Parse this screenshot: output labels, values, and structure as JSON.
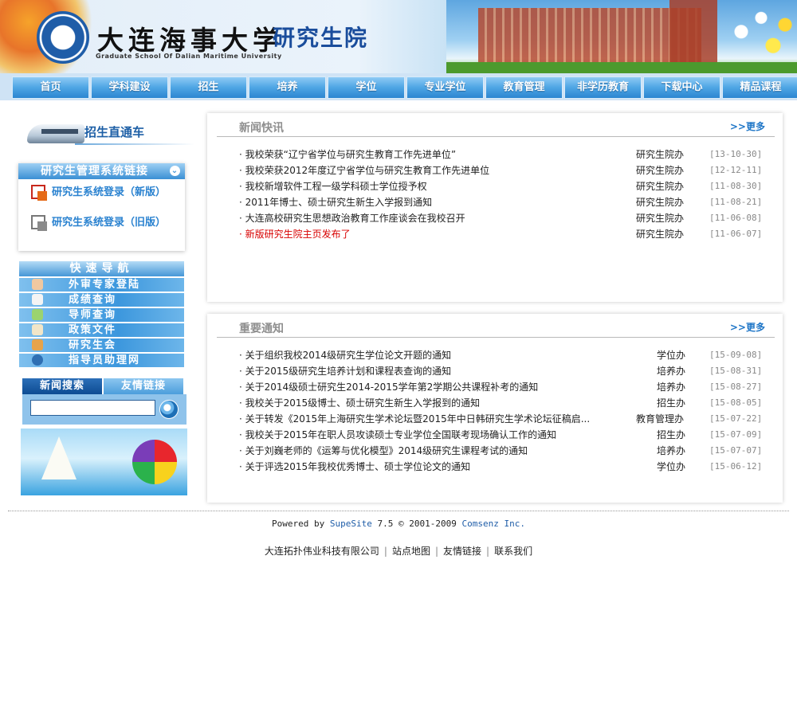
{
  "header": {
    "title_cn": "大连海事大学",
    "subtitle_cn": "研究生院",
    "title_en": "Graduate School Of Dalian Maritime University"
  },
  "nav": [
    "首页",
    "学科建设",
    "招生",
    "培养",
    "学位",
    "专业学位",
    "教育管理",
    "非学历教育",
    "下载中心",
    "精品课程"
  ],
  "sidebar": {
    "train_label": "招生直通车",
    "system_links": {
      "title": "研究生管理系统链接",
      "items": [
        "研究生系统登录（新版）",
        "研究生系统登录（旧版）"
      ]
    },
    "quick_nav": {
      "title": "快速导航",
      "items": [
        "外审专家登陆",
        "成绩查询",
        "导师查询",
        "政策文件",
        "研究生会",
        "指导员助理网"
      ]
    },
    "search_tabs": [
      "新闻搜索",
      "友情链接"
    ],
    "search_input": {
      "value": "",
      "placeholder": ""
    }
  },
  "news": {
    "title": "新闻快讯",
    "more": ">>更多",
    "items": [
      {
        "title": "我校荣获“辽宁省学位与研究生教育工作先进单位”",
        "dept": "研究生院办",
        "date": "[13-10-30]",
        "highlight": false
      },
      {
        "title": "我校荣获2012年度辽宁省学位与研究生教育工作先进单位",
        "dept": "研究生院办",
        "date": "[12-12-11]",
        "highlight": false
      },
      {
        "title": "我校新增软件工程一级学科硕士学位授予权",
        "dept": "研究生院办",
        "date": "[11-08-30]",
        "highlight": false
      },
      {
        "title": "2011年博士、硕士研究生新生入学报到通知",
        "dept": "研究生院办",
        "date": "[11-08-21]",
        "highlight": false
      },
      {
        "title": "大连高校研究生思想政治教育工作座谈会在我校召开",
        "dept": "研究生院办",
        "date": "[11-06-08]",
        "highlight": false
      },
      {
        "title": "新版研究生院主页发布了",
        "dept": "研究生院办",
        "date": "[11-06-07]",
        "highlight": true
      }
    ]
  },
  "notice": {
    "title": "重要通知",
    "more": ">>更多",
    "items": [
      {
        "title": "关于组织我校2014级研究生学位论文开题的通知",
        "dept": "学位办",
        "date": "[15-09-08]"
      },
      {
        "title": "关于2015级研究生培养计划和课程表查询的通知",
        "dept": "培养办",
        "date": "[15-08-31]"
      },
      {
        "title": "关于2014级硕士研究生2014-2015学年第2学期公共课程补考的通知",
        "dept": "培养办",
        "date": "[15-08-27]"
      },
      {
        "title": "我校关于2015级博士、硕士研究生新生入学报到的通知",
        "dept": "招生办",
        "date": "[15-08-05]"
      },
      {
        "title": "关于转发《2015年上海研究生学术论坛暨2015年中日韩研究生学术论坛征稿启...",
        "dept": "教育管理办",
        "date": "[15-07-22]"
      },
      {
        "title": "我校关于2015年在职人员攻读硕士专业学位全国联考现场确认工作的通知",
        "dept": "招生办",
        "date": "[15-07-09]"
      },
      {
        "title": "关于刘巍老师的《运筹与优化模型》2014级研究生课程考试的通知",
        "dept": "培养办",
        "date": "[15-07-07]"
      },
      {
        "title": "关于评选2015年我校优秀博士、硕士学位论文的通知",
        "dept": "学位办",
        "date": "[15-06-12]"
      }
    ]
  },
  "footer": {
    "powered_prefix": "Powered by ",
    "powered_product": "SupeSite",
    "powered_version": " 7.5 © 2001-2009 ",
    "powered_company": "Comsenz Inc.",
    "links": [
      "大连拓扑伟业科技有限公司",
      "站点地图",
      "友情链接",
      "联系我们"
    ]
  },
  "colors": {
    "accent": "#2a82d0",
    "nav": "#4ea5e4",
    "highlight": "#d80000",
    "panel_title": "#8f8f8f"
  },
  "icons": {
    "quick_nav": [
      "person-icon",
      "document-icon",
      "teacher-icon",
      "book-icon",
      "group-icon",
      "phone-icon"
    ]
  }
}
